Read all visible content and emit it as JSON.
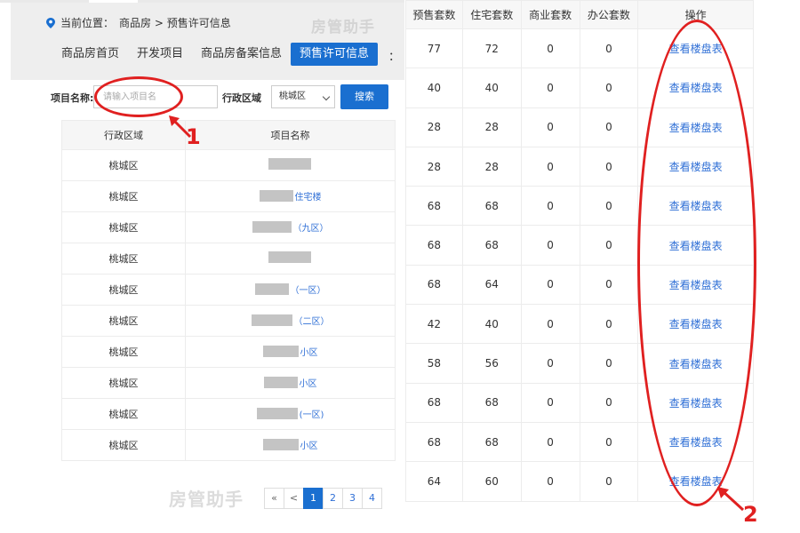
{
  "breadcrumb": {
    "prefix": "当前位置：",
    "path": "商品房 > 预售许可信息"
  },
  "watermark": "房管助手",
  "nav": {
    "items": [
      {
        "label": "商品房首页",
        "active": false
      },
      {
        "label": "开发项目",
        "active": false
      },
      {
        "label": "商品房备案信息",
        "active": false
      },
      {
        "label": "预售许可信息",
        "active": true
      }
    ],
    "more": "："
  },
  "search": {
    "project_label": "项目名称:",
    "project_placeholder": "请输入项目名",
    "district_label": "行政区域",
    "district_value": "桃城区",
    "button": "搜索"
  },
  "left_table": {
    "headers": [
      "行政区域",
      "项目名称"
    ],
    "rows": [
      {
        "district": "桃城区",
        "suffix": ""
      },
      {
        "district": "桃城区",
        "suffix": "住宅楼"
      },
      {
        "district": "桃城区",
        "suffix": "（九区）"
      },
      {
        "district": "桃城区",
        "suffix": ""
      },
      {
        "district": "桃城区",
        "suffix": "（一区）"
      },
      {
        "district": "桃城区",
        "suffix": "（二区）"
      },
      {
        "district": "桃城区",
        "suffix": "小区"
      },
      {
        "district": "桃城区",
        "suffix": "小区"
      },
      {
        "district": "桃城区",
        "suffix": "(一区)"
      },
      {
        "district": "桃城区",
        "suffix": "小区"
      }
    ]
  },
  "pagination": {
    "first": "«",
    "prev": "<",
    "pages": [
      "1",
      "2",
      "3",
      "4"
    ],
    "current": "1"
  },
  "right_table": {
    "headers": [
      "预售套数",
      "住宅套数",
      "商业套数",
      "办公套数",
      "操作"
    ],
    "rows": [
      [
        "77",
        "72",
        "0",
        "0",
        "查看楼盘表"
      ],
      [
        "40",
        "40",
        "0",
        "0",
        "查看楼盘表"
      ],
      [
        "28",
        "28",
        "0",
        "0",
        "查看楼盘表"
      ],
      [
        "28",
        "28",
        "0",
        "0",
        "查看楼盘表"
      ],
      [
        "68",
        "68",
        "0",
        "0",
        "查看楼盘表"
      ],
      [
        "68",
        "68",
        "0",
        "0",
        "查看楼盘表"
      ],
      [
        "68",
        "64",
        "0",
        "0",
        "查看楼盘表"
      ],
      [
        "42",
        "40",
        "0",
        "0",
        "查看楼盘表"
      ],
      [
        "58",
        "56",
        "0",
        "0",
        "查看楼盘表"
      ],
      [
        "68",
        "68",
        "0",
        "0",
        "查看楼盘表"
      ],
      [
        "68",
        "68",
        "0",
        "0",
        "查看楼盘表"
      ],
      [
        "64",
        "60",
        "0",
        "0",
        "查看楼盘表"
      ]
    ]
  },
  "annotations": {
    "marker1": "1",
    "marker2": "2"
  }
}
